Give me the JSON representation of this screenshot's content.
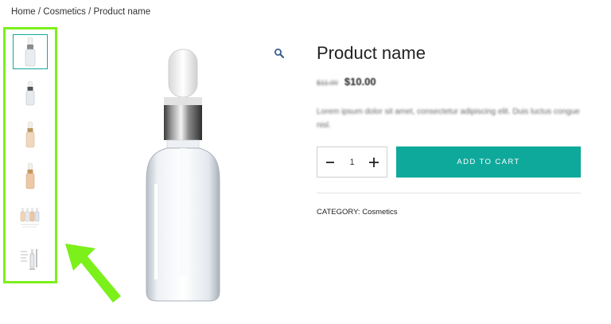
{
  "breadcrumb": {
    "text": "Home / Cosmetics / Product name"
  },
  "gallery": {
    "thumbnails": [
      {
        "name": "dropper-bottle-clear-front",
        "active": true
      },
      {
        "name": "dropper-bottle-clear-small",
        "active": false
      },
      {
        "name": "dropper-bottle-amber",
        "active": false
      },
      {
        "name": "dropper-bottle-amber-small",
        "active": false
      },
      {
        "name": "dropper-bottle-set",
        "active": false
      },
      {
        "name": "dropper-bottle-dimensions",
        "active": false
      }
    ],
    "highlight_color": "#7cf01a"
  },
  "product": {
    "title": "Product name",
    "price_old": "$11.00",
    "price_new": "$10.00",
    "description": "Lorem ipsum dolor sit amet, consectetur adipiscing elit. Duis luctus congue nisl.",
    "quantity": "1",
    "add_to_cart_label": "ADD TO CART",
    "category_label": "CATEGORY:",
    "category_value": "Cosmetics"
  },
  "colors": {
    "accent": "#0fa99b",
    "highlight": "#7cf01a"
  },
  "icons": {
    "zoom": "magnifier-icon",
    "decrease": "minus-icon",
    "increase": "plus-icon"
  }
}
